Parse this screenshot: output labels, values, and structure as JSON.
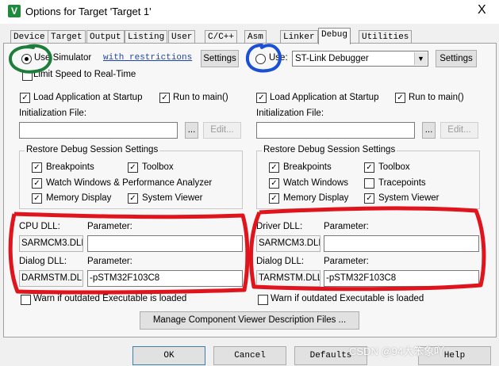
{
  "window": {
    "title": "Options for Target 'Target 1'",
    "close": "X"
  },
  "tabs": [
    "Device",
    "Target",
    "Output",
    "Listing",
    "User",
    "C/C++",
    "Asm",
    "Linker",
    "Debug",
    "Utilities"
  ],
  "left": {
    "use_label": "Use Simulator",
    "restrictions_link": "with restrictions",
    "settings": "Settings",
    "limit_speed": "Limit Speed to Real-Time",
    "load_app": "Load Application at Startup",
    "run_main": "Run to main()",
    "init_label": "Initialization File:",
    "browse": "...",
    "edit": "Edit...",
    "restore_title": "Restore Debug Session Settings",
    "breakpoints": "Breakpoints",
    "toolbox": "Toolbox",
    "watch": "Watch Windows & Performance Analyzer",
    "memory": "Memory Display",
    "sysviewer": "System Viewer",
    "cpu_dll_label": "CPU DLL:",
    "param_label": "Parameter:",
    "cpu_dll_value": "SARMCM3.DLL",
    "cpu_param_value": "",
    "dialog_dll_label": "Dialog DLL:",
    "dialog_dll_value": "DARMSTM.DLL",
    "dialog_param_value": "-pSTM32F103C8",
    "warn": "Warn if outdated Executable is loaded"
  },
  "right": {
    "use_label": "Use:",
    "debugger": "ST-Link Debugger",
    "settings": "Settings",
    "load_app": "Load Application at Startup",
    "run_main": "Run to main()",
    "init_label": "Initialization File:",
    "browse": "...",
    "edit": "Edit...",
    "restore_title": "Restore Debug Session Settings",
    "breakpoints": "Breakpoints",
    "toolbox": "Toolbox",
    "watch": "Watch Windows",
    "tracepoints": "Tracepoints",
    "memory": "Memory Display",
    "sysviewer": "System Viewer",
    "driver_dll_label": "Driver DLL:",
    "param_label": "Parameter:",
    "driver_dll_value": "SARMCM3.DLL",
    "driver_param_value": "",
    "dialog_dll_label": "Dialog DLL:",
    "dialog_dll_value": "TARMSTM.DLL",
    "dialog_param_value": "-pSTM32F103C8",
    "warn": "Warn if outdated Executable is loaded"
  },
  "manage_button": "Manage Component Viewer Description Files ...",
  "footer": {
    "ok": "OK",
    "cancel": "Cancel",
    "defaults": "Defaults",
    "help": "Help"
  },
  "watermark": "CSDN @94大笨象吖",
  "check_mark": "✓",
  "accent_colors": {
    "annotation_red": "#e0141c",
    "annotation_green": "#1e7d3a",
    "annotation_blue": "#1a4fd6"
  }
}
